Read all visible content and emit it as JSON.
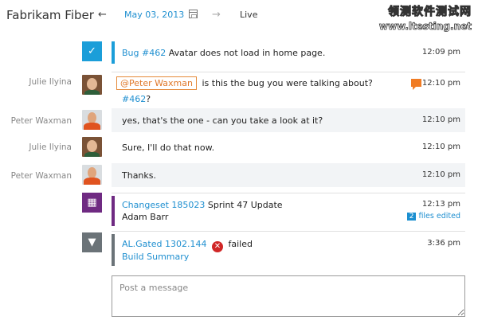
{
  "header": {
    "team_name": "Fabrikam Fiber",
    "back_icon": "←",
    "date": "May 03, 2013",
    "forward_icon": "→",
    "live_label": "Live"
  },
  "watermark": {
    "line1": "领测软件测试网",
    "line2": "www.ltesting.net"
  },
  "messages": [
    {
      "type": "work-item",
      "icon": "bug-icon",
      "link": "Bug #462",
      "text": " Avatar does not load in home page.",
      "time": "12:09 pm"
    },
    {
      "type": "chat",
      "sender": "Julie Ilyina",
      "mention": "@Peter Waxman",
      "text": "is this the bug you were talking about?",
      "link": "#462",
      "suffix": "?",
      "time": "12:10 pm"
    },
    {
      "type": "chat",
      "sender": "Peter Waxman",
      "text": "yes, that's the one - can you take a look at it?",
      "time": "12:10 pm"
    },
    {
      "type": "chat",
      "sender": "Julie Ilyina",
      "text": "Sure, I'll do that now.",
      "time": "12:10 pm"
    },
    {
      "type": "chat",
      "sender": "Peter Waxman",
      "text": "Thanks.",
      "time": "12:10 pm"
    },
    {
      "type": "changeset",
      "link": "Changeset 185023",
      "title": " Sprint 47 Update",
      "author": "Adam Barr",
      "time": "12:13 pm",
      "files_count": "2",
      "files_label": "files edited"
    },
    {
      "type": "build",
      "link": "AL.Gated 1302.144",
      "status": "failed",
      "summary_link": "Build Summary",
      "time": "3:36 pm"
    }
  ],
  "composer": {
    "placeholder": "Post a message"
  },
  "colors": {
    "accent_blue": "#1f8fd0",
    "bug_tile": "#1b9ed9",
    "changeset_tile": "#6f2a82",
    "build_tile": "#6b7378",
    "mention_orange": "#e0782a",
    "failed_red": "#d02626"
  }
}
